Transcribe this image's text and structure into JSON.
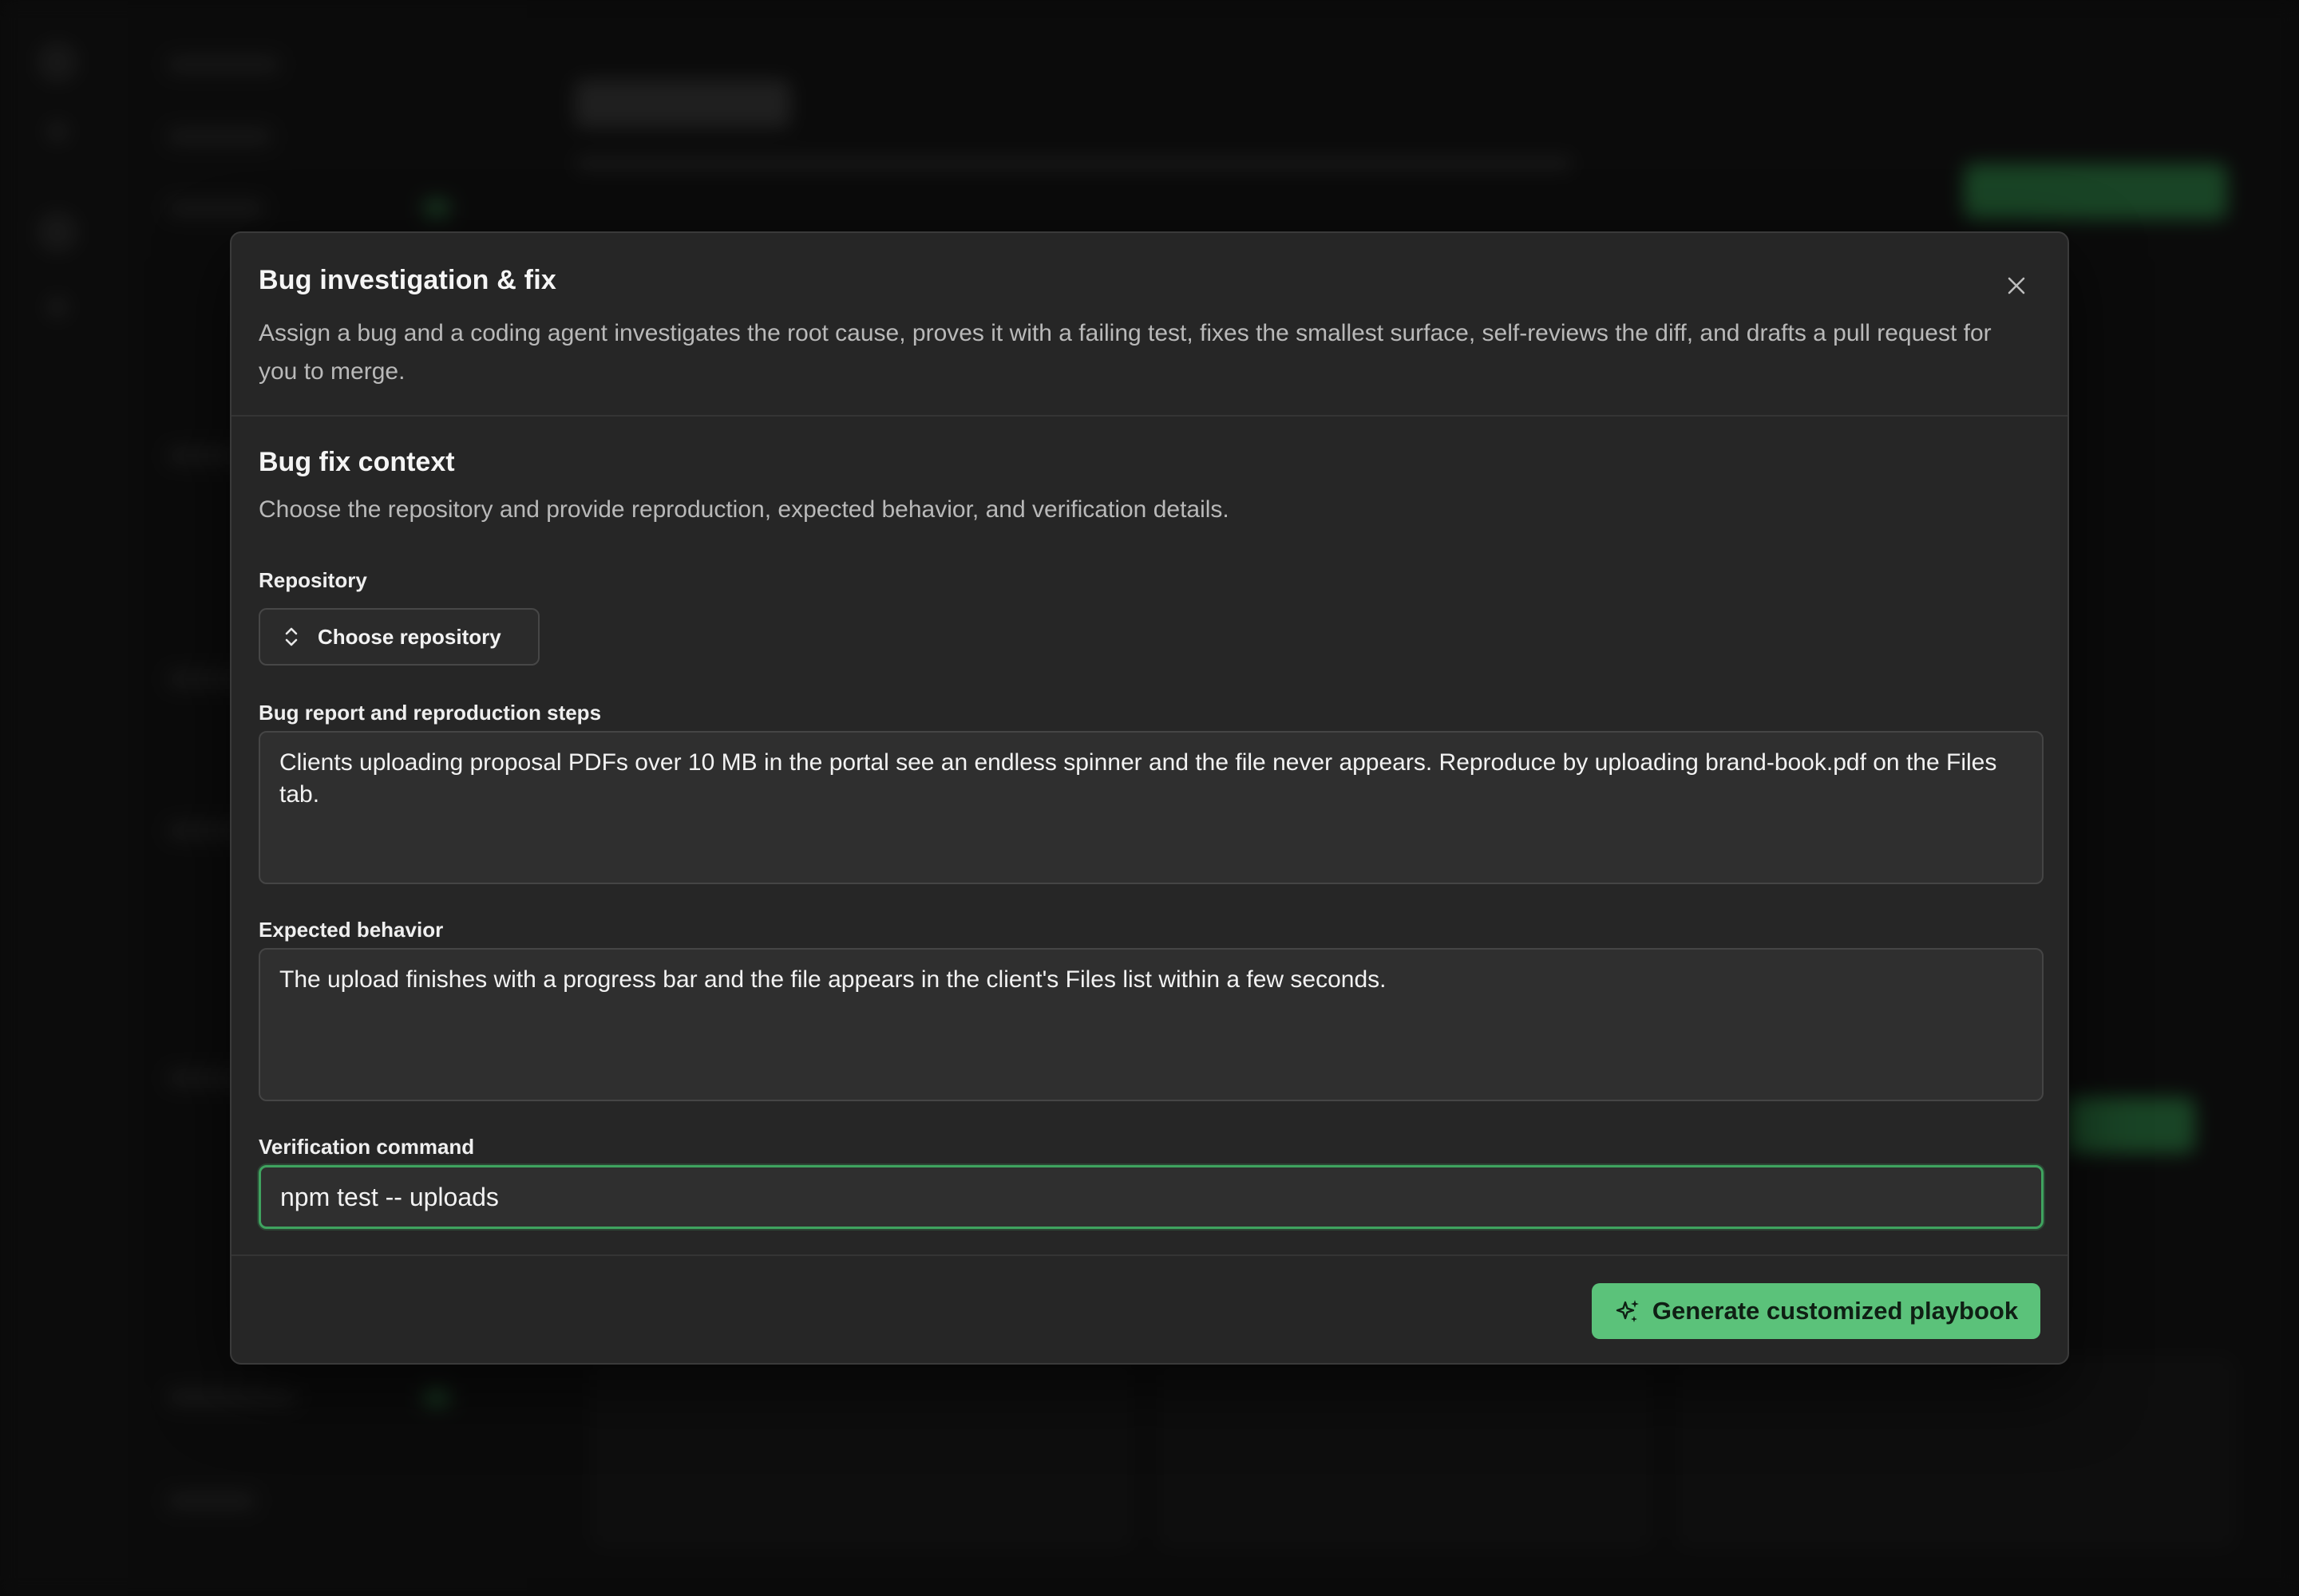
{
  "dialog": {
    "title": "Bug investigation & fix",
    "description": "Assign a bug and a coding agent investigates the root cause, proves it with a failing test, fixes the smallest surface, self-reviews the diff, and drafts a pull request for you to merge.",
    "close_icon": "close-icon"
  },
  "section": {
    "title": "Bug fix context",
    "description": "Choose the repository and provide reproduction, expected behavior, and verification details."
  },
  "repository": {
    "label": "Repository",
    "button_label": "Choose repository",
    "icon": "chevron-up-down-icon"
  },
  "bug_report": {
    "label": "Bug report and reproduction steps",
    "value": "Clients uploading proposal PDFs over 10 MB in the portal see an endless spinner and the file never appears. Reproduce by uploading brand-book.pdf on the Files tab."
  },
  "expected": {
    "label": "Expected behavior",
    "value": "The upload finishes with a progress bar and the file appears in the client's Files list within a few seconds."
  },
  "verification": {
    "label": "Verification command",
    "value": "npm test -- uploads"
  },
  "footer": {
    "primary_label": "Generate customized playbook",
    "primary_icon": "sparkles-icon"
  },
  "colors": {
    "accent": "#5bc27a",
    "focus_ring": "#3fa35f",
    "dialog_bg": "#262626"
  }
}
